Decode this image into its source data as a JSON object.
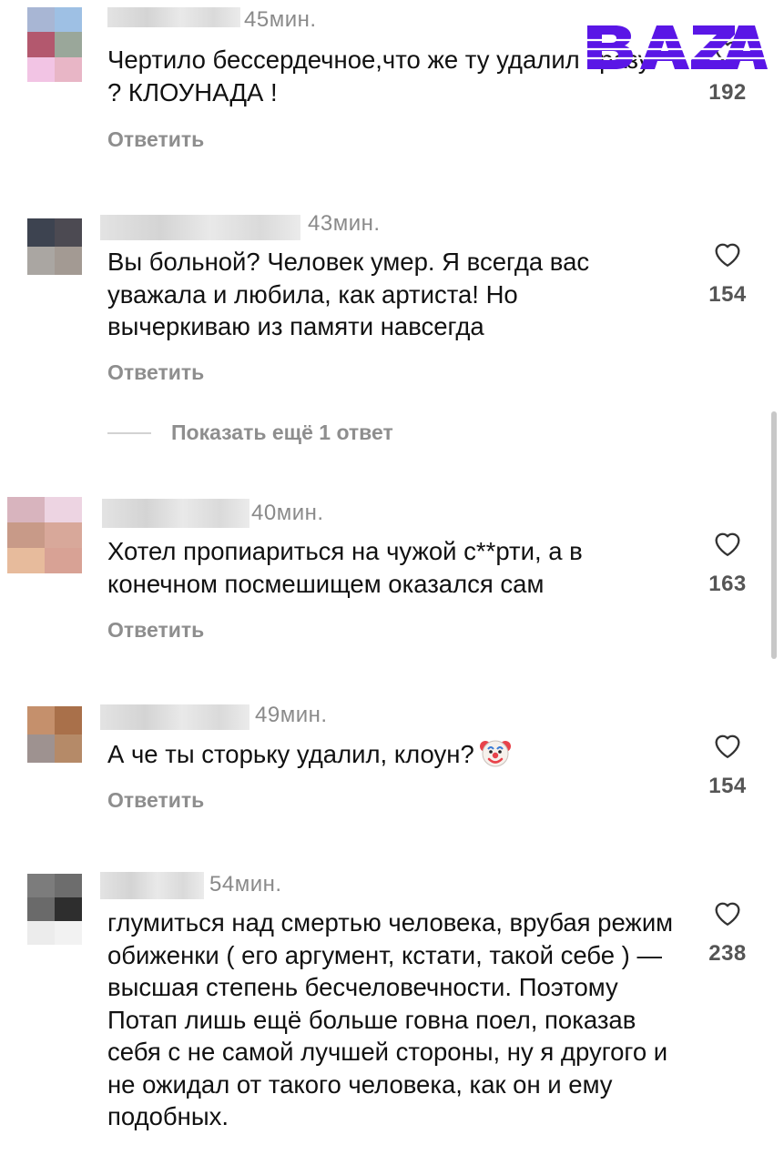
{
  "watermark": {
    "brand": "BAZA",
    "color": "#5a16e6"
  },
  "labels": {
    "reply": "Ответить",
    "show_more_replies": "Показать ещё 1 ответ"
  },
  "comments": [
    {
      "time": "45мин.",
      "text": "Чертило бессердечное,что же ту удалил сразу ? КЛОУНАДА !",
      "likes": "192"
    },
    {
      "time": "43мин.",
      "text": "Вы больной? Человек умер. Я всегда вас уважала и любила, как артиста! Но вычеркиваю из памяти навсегда",
      "likes": "154"
    },
    {
      "time": "40мин.",
      "text": "Хотел пропиариться на чужой с**рти, а в конечном посмешищем оказался сам",
      "likes": "163"
    },
    {
      "time": "49мин.",
      "text": "А че ты сторьку удалил, клоун?",
      "emoji": "clown-face",
      "likes": "154"
    },
    {
      "time": "54мин.",
      "text": "глумиться над смертью человека, врубая режим обиженки ( его аргумент, кстати, такой себе ) — высшая степень бесчеловечности. Поэтому Потап лишь ещё больше говна поел, показав себя с не самой лучшей стороны, ну я другого и не ожидал от такого человека, как он и ему подобных.",
      "likes": "238"
    }
  ]
}
